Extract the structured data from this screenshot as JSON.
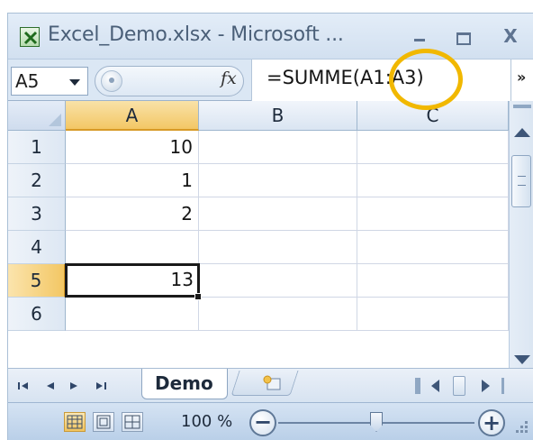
{
  "window": {
    "title": "Excel_Demo.xlsx - Microsoft ...",
    "minimize_icon": "minimize-icon",
    "maximize_icon": "maximize-icon",
    "close_icon": "close-icon",
    "close_glyph": "X"
  },
  "formula_bar": {
    "name_box": "A5",
    "fx_label": "fx",
    "formula": "=SUMME(A1:A3)",
    "expand_glyph": "»",
    "highlight_color": "#f1b800"
  },
  "grid": {
    "columns": [
      "A",
      "B",
      "C"
    ],
    "active_column": "A",
    "rows": [
      {
        "label": "1",
        "A": "10",
        "B": "",
        "C": ""
      },
      {
        "label": "2",
        "A": "1",
        "B": "",
        "C": ""
      },
      {
        "label": "3",
        "A": "2",
        "B": "",
        "C": ""
      },
      {
        "label": "4",
        "A": "",
        "B": "",
        "C": ""
      },
      {
        "label": "5",
        "A": "13",
        "B": "",
        "C": ""
      },
      {
        "label": "6",
        "A": "",
        "B": "",
        "C": ""
      }
    ],
    "selected_cell": "A5",
    "selection_color": "#1a1a1a",
    "header_active_color": "#f3c765"
  },
  "sheet_tabs": {
    "nav": [
      "|◄",
      "◄",
      "►",
      "►|"
    ],
    "tabs": [
      "Demo"
    ],
    "active_tab": "Demo",
    "new_sheet_icon": "insert-worksheet-icon"
  },
  "status_bar": {
    "views": [
      "normal-view-icon",
      "page-layout-view-icon",
      "page-break-preview-icon"
    ],
    "zoom": "100 %",
    "zoom_minus": "−",
    "zoom_plus": "+"
  }
}
